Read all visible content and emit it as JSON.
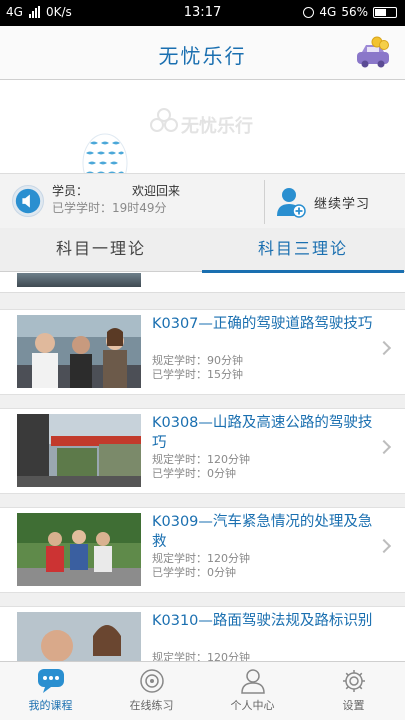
{
  "status_bar": {
    "network": "4G",
    "speed": "0K/s",
    "time": "13:17",
    "network_right": "4G",
    "battery": "56%",
    "battery_level": 0.56
  },
  "header": {
    "title": "无忧乐行",
    "car_icon": "car-coins-icon"
  },
  "banner": {
    "watermark": "无忧乐行"
  },
  "user": {
    "greeting_prefix": "学员：",
    "greeting_suffix": "欢迎回来",
    "studied_label": "已学学时：19时49分",
    "continue_label": "继续学习"
  },
  "tabs": [
    {
      "label": "科目一理论",
      "active": false
    },
    {
      "label": "科目三理论",
      "active": true
    }
  ],
  "courses": [
    {
      "title": "K0307—正确的驾驶道路驾驶技巧",
      "required": "规定学时：90分钟",
      "studied": "已学学时：15分钟"
    },
    {
      "title": "K0308—山路及高速公路的驾驶技巧",
      "required": "规定学时：120分钟",
      "studied": "已学学时：0分钟"
    },
    {
      "title": "K0309—汽车紧急情况的处理及急救",
      "required": "规定学时：120分钟",
      "studied": "已学学时：0分钟"
    },
    {
      "title": "K0310—路面驾驶法规及路标识别",
      "required": "规定学时：120分钟",
      "studied": ""
    }
  ],
  "bottom_nav": [
    {
      "label": "我的课程",
      "icon": "chat-bubble-icon",
      "active": true
    },
    {
      "label": "在线练习",
      "icon": "target-icon",
      "active": false
    },
    {
      "label": "个人中心",
      "icon": "person-icon",
      "active": false
    },
    {
      "label": "设置",
      "icon": "gear-icon",
      "active": false
    }
  ],
  "colors": {
    "accent": "#1a6fb0",
    "header_bg": "#fafafa",
    "list_bg": "#f0f0f0"
  }
}
